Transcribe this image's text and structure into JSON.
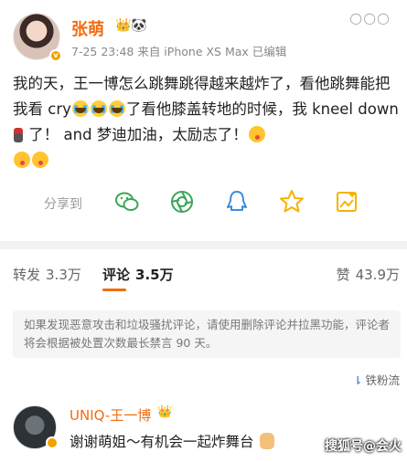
{
  "post": {
    "author": "张萌",
    "meta": "7-25 23:48  来自 iPhone XS Max  已编辑",
    "text_1": "我的天，王一博怎么跳舞跳得越来越炸了，看他跳舞能把我看 cry",
    "text_2": "了看他膝盖转地的时候，我 kneel down",
    "text_3": "了！ and 梦迪加油，太励志了！"
  },
  "share": {
    "label": "分享到",
    "icons": [
      "wechat-icon",
      "moments-icon",
      "qq-icon",
      "qzone-icon",
      "save-image-icon"
    ],
    "colors": {
      "green": "#3aa655",
      "blue": "#3b8ee0",
      "yellow": "#f5b400"
    }
  },
  "tabs": [
    {
      "label": "转发",
      "count": "3.3万"
    },
    {
      "label": "评论",
      "count": "3.5万"
    },
    {
      "label": "赞",
      "count": "43.9万"
    }
  ],
  "notice": "如果发现恶意攻击和垃圾骚扰评论，请使用删除评论并拉黑功能，评论者将会根据被处置次数最长禁言 90 天。",
  "sort_label": "铁粉流",
  "comment": {
    "author": "UNIQ-王一博",
    "text": "谢谢萌姐～有机会一起炸舞台"
  },
  "watermark": "搜狐号@会火",
  "accent_color": "#f26b10"
}
